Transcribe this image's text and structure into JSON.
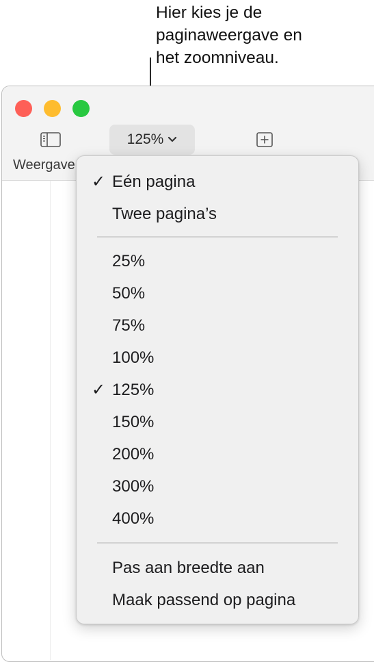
{
  "callout": {
    "line1": "Hier kies je de",
    "line2": "paginaweergave en",
    "line3": "het zoomniveau."
  },
  "toolbar": {
    "view_label": "Weergave",
    "zoom_value": "125%"
  },
  "icons": {
    "view": "sidebar-view-icon",
    "zoom_chevron": "chevron-down-icon",
    "insert": "plus-square-icon",
    "check": "checkmark-icon"
  },
  "colors": {
    "close": "#fe5f57",
    "minimize": "#febc2e",
    "zoom": "#28c840",
    "menu_bg": "#f0f0f0"
  },
  "menu": {
    "check_glyph": "✓",
    "items": [
      {
        "label": "Eén pagina",
        "checked": true
      },
      {
        "label": "Twee pagina’s",
        "checked": false
      },
      {
        "label": "25%",
        "checked": false
      },
      {
        "label": "50%",
        "checked": false
      },
      {
        "label": "75%",
        "checked": false
      },
      {
        "label": "100%",
        "checked": false
      },
      {
        "label": "125%",
        "checked": true
      },
      {
        "label": "150%",
        "checked": false
      },
      {
        "label": "200%",
        "checked": false
      },
      {
        "label": "300%",
        "checked": false
      },
      {
        "label": "400%",
        "checked": false
      },
      {
        "label": "Pas aan breedte aan",
        "checked": false
      },
      {
        "label": "Maak passend op pagina",
        "checked": false
      }
    ]
  }
}
